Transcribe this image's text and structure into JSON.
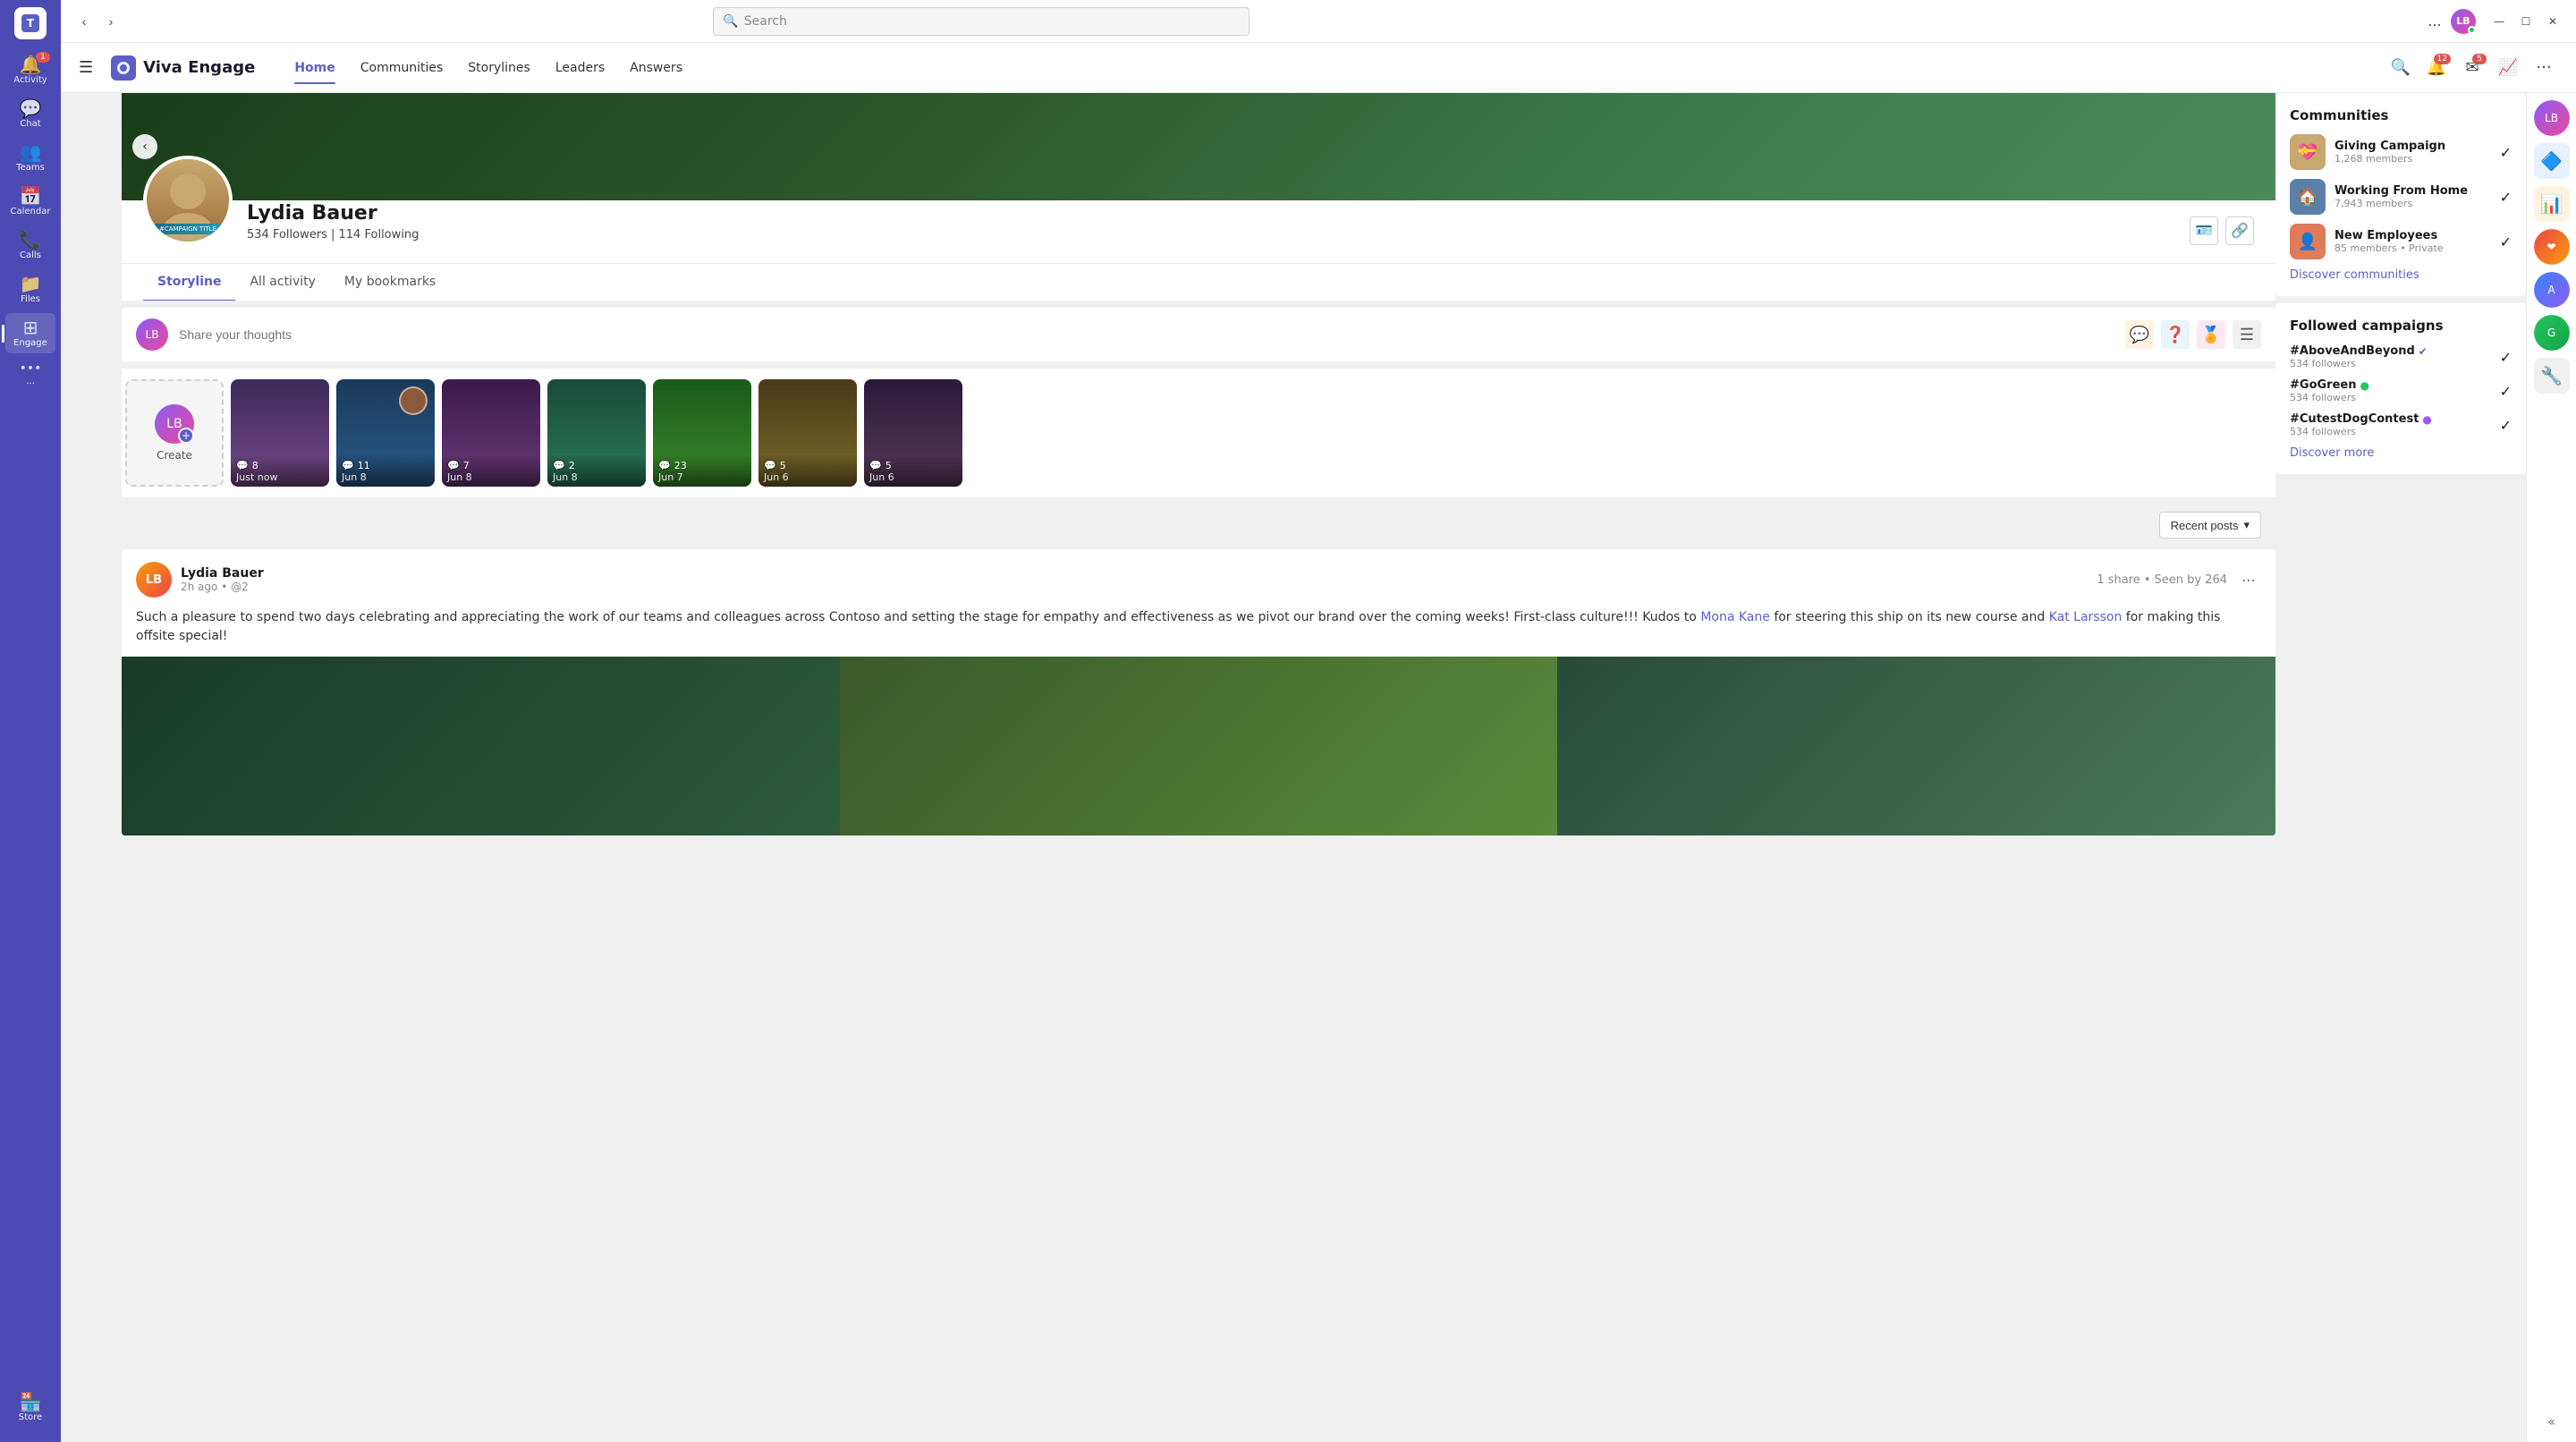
{
  "titleBar": {
    "searchPlaceholder": "Search",
    "moreLabel": "...",
    "windowControls": {
      "minimize": "—",
      "maximize": "☐",
      "close": "✕"
    }
  },
  "appHeader": {
    "logoText": "Viva Engage",
    "nav": [
      {
        "id": "home",
        "label": "Home",
        "active": true
      },
      {
        "id": "communities",
        "label": "Communities",
        "active": false
      },
      {
        "id": "storylines",
        "label": "Storylines",
        "active": false
      },
      {
        "id": "leaders",
        "label": "Leaders",
        "active": false
      },
      {
        "id": "answers",
        "label": "Answers",
        "active": false
      }
    ],
    "notificationBadge": "12",
    "messageBadge": "5"
  },
  "leftNav": {
    "items": [
      {
        "id": "activity",
        "label": "Activity",
        "icon": "🔔",
        "badge": "1"
      },
      {
        "id": "chat",
        "label": "Chat",
        "icon": "💬",
        "badge": ""
      },
      {
        "id": "teams",
        "label": "Teams",
        "icon": "👥",
        "badge": ""
      },
      {
        "id": "calendar",
        "label": "Calendar",
        "icon": "📅",
        "badge": ""
      },
      {
        "id": "calls",
        "label": "Calls",
        "icon": "📞",
        "badge": ""
      },
      {
        "id": "files",
        "label": "Files",
        "icon": "📁",
        "badge": ""
      },
      {
        "id": "engage",
        "label": "Engage",
        "icon": "⊞",
        "badge": "",
        "active": true
      },
      {
        "id": "more",
        "label": "...",
        "icon": "···",
        "badge": ""
      }
    ],
    "bottom": [
      {
        "id": "store",
        "label": "Store",
        "icon": "⊞",
        "badge": ""
      }
    ]
  },
  "profile": {
    "name": "Lydia Bauer",
    "followers": "534",
    "following": "114",
    "followersLabel": "Followers",
    "followingLabel": "Following",
    "campaignBadge": "#CAMPAIGN TITLE",
    "tabs": [
      {
        "id": "storyline",
        "label": "Storyline",
        "active": true
      },
      {
        "id": "all-activity",
        "label": "All activity",
        "active": false
      },
      {
        "id": "bookmarks",
        "label": "My bookmarks",
        "active": false
      }
    ]
  },
  "shareBox": {
    "placeholder": "Share your thoughts"
  },
  "stories": [
    {
      "id": "create",
      "label": "Create"
    },
    {
      "id": "s1",
      "comments": "8",
      "date": "Just now"
    },
    {
      "id": "s2",
      "comments": "11",
      "date": "Jun 8"
    },
    {
      "id": "s3",
      "comments": "7",
      "date": "Jun 8"
    },
    {
      "id": "s4",
      "comments": "2",
      "date": "Jun 8"
    },
    {
      "id": "s5",
      "comments": "23",
      "date": "Jun 7"
    },
    {
      "id": "s6",
      "comments": "5",
      "date": "Jun 6"
    },
    {
      "id": "s7",
      "comments": "5",
      "date": "Jun 6"
    }
  ],
  "recentPostsBtn": "Recent posts",
  "post": {
    "author": "Lydia Bauer",
    "time": "2h ago",
    "mention": "@2",
    "shares": "1 share",
    "seenBy": "Seen by 264",
    "body": "Such a pleasure to spend two days celebrating and appreciating the work of our teams and colleagues across Contoso and setting the stage for empathy and effectiveness as we pivot our brand over the coming weeks! First-class culture!!! Kudos to",
    "link1": "Mona Kane",
    "bodyMiddle": "for steering this ship on its new course and",
    "link2": "Kat Larsson",
    "bodyEnd": "for making this offsite special!"
  },
  "sidebar": {
    "communitiesTitle": "Communities",
    "communities": [
      {
        "id": "giving",
        "name": "Giving Campaign",
        "members": "1,268 members",
        "color": "#c8a870"
      },
      {
        "id": "wfh",
        "name": "Working From Home",
        "members": "7,943 members",
        "color": "#5b7fa6"
      },
      {
        "id": "new-employees",
        "name": "New Employees",
        "members": "85 members • Private",
        "color": "#e07b5a"
      }
    ],
    "discoverCommunitiesLabel": "Discover communities",
    "campaignsTitle": "Followed campaigns",
    "campaigns": [
      {
        "id": "above-beyond",
        "name": "#AboveAndBeyond",
        "dotColor": "#5b5fc7",
        "dotVerified": true,
        "followers": "534 followers"
      },
      {
        "id": "go-green",
        "name": "#GoGreen",
        "dotColor": "#22c55e",
        "dotVerified": true,
        "followers": "534 followers"
      },
      {
        "id": "cutest-dog",
        "name": "#CutestDogContest",
        "dotColor": "#a855f7",
        "dotVerified": true,
        "followers": "534 followers"
      }
    ],
    "discoverMoreLabel": "Discover more"
  },
  "farRight": {
    "collapseLabel": "«"
  }
}
